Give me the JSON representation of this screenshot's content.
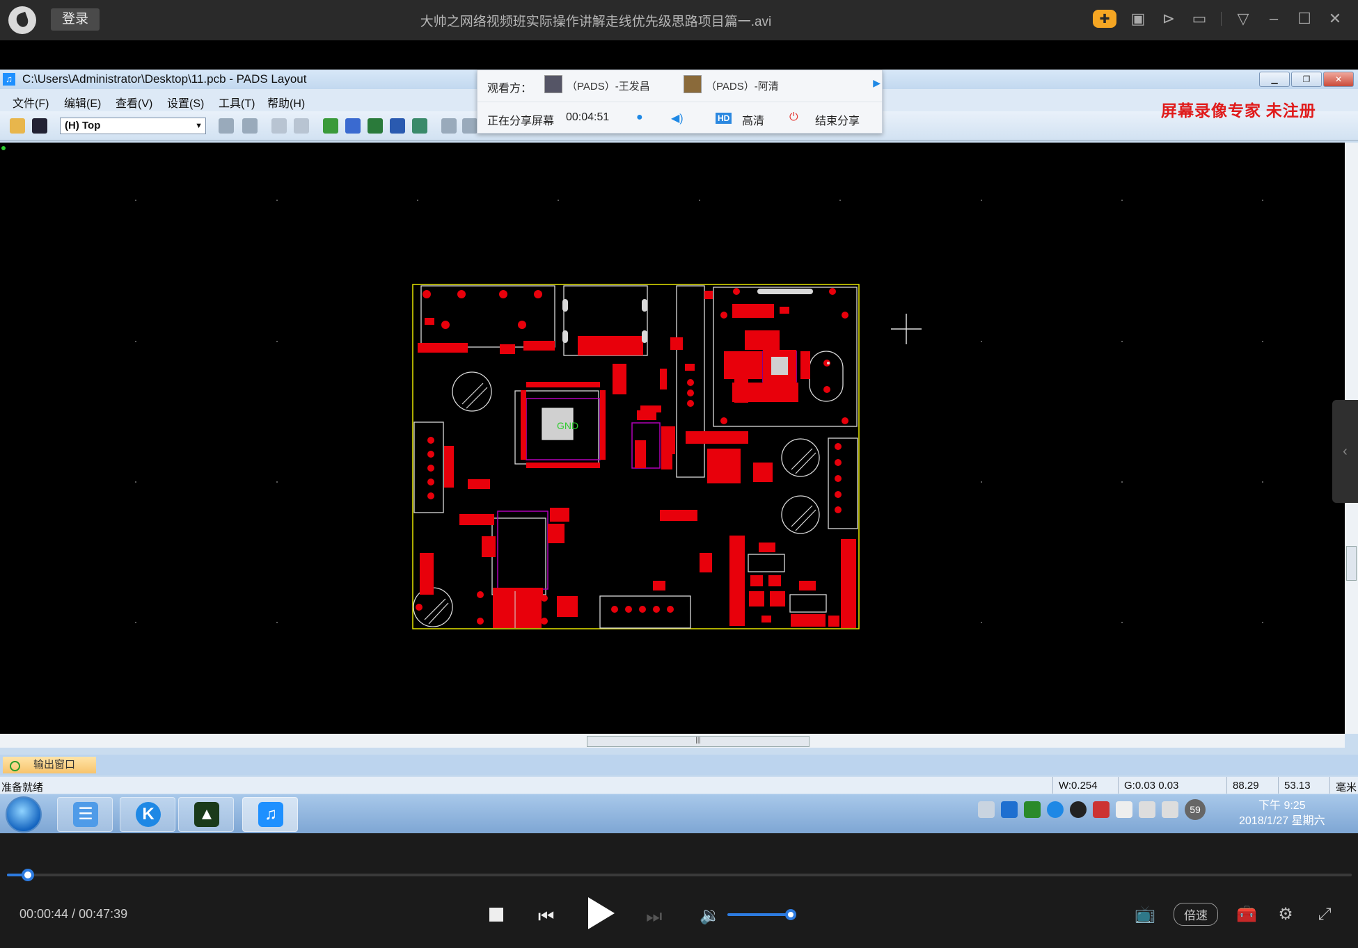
{
  "player": {
    "login_label": "登录",
    "video_title": "大帅之网络视频班实际操作讲解走线优先级思路项目篇一.avi",
    "top_icons": [
      "gamepad-icon",
      "layout-icon",
      "pin-icon",
      "folder-icon",
      "menu-down-icon",
      "minimize-icon",
      "maximize-icon",
      "close-icon"
    ],
    "current_time": "00:00:44",
    "total_time": "00:47:39",
    "time_separator": " / ",
    "progress_fraction": 0.0154,
    "volume_fraction": 1.0,
    "speed_label": "倍速"
  },
  "pads": {
    "window_title": "C:\\Users\\Administrator\\Desktop\\11.pcb - PADS Layout",
    "app_icon_glyph": "♫",
    "menu": [
      "文件(F)",
      "编辑(E)",
      "查看(V)",
      "设置(S)",
      "工具(T)",
      "帮助(H)"
    ],
    "layer_select": "(H) Top",
    "watermark": "屏幕录像专家  未注册",
    "output_tab": "输出窗口",
    "status_left": "准备就绪",
    "status_w": "W:0.254",
    "status_g": "G:0.03 0.03",
    "status_x": "88.29",
    "status_y": "53.13",
    "status_unit": "毫米",
    "gnd_label": "GND"
  },
  "share": {
    "viewers_label": "观看方：",
    "viewer1": "（PADS）-王发昌",
    "viewer2": "（PADS）-阿清",
    "sharing_label": "正在分享屏幕",
    "sharing_time": "00:04:51",
    "hd_badge": "HD",
    "hd_label": "高清",
    "end_label": "结束分享"
  },
  "taskbar": {
    "tray_badge": "59",
    "clock_time": "下午 9:25",
    "clock_date": "2018/1/27 星期六"
  },
  "colors": {
    "pad_red": "#e8000b",
    "board_outline": "#e6e600",
    "silk_white": "#d9d9d9",
    "component_purple": "#b000b8",
    "accent_blue": "#2d7be0"
  }
}
